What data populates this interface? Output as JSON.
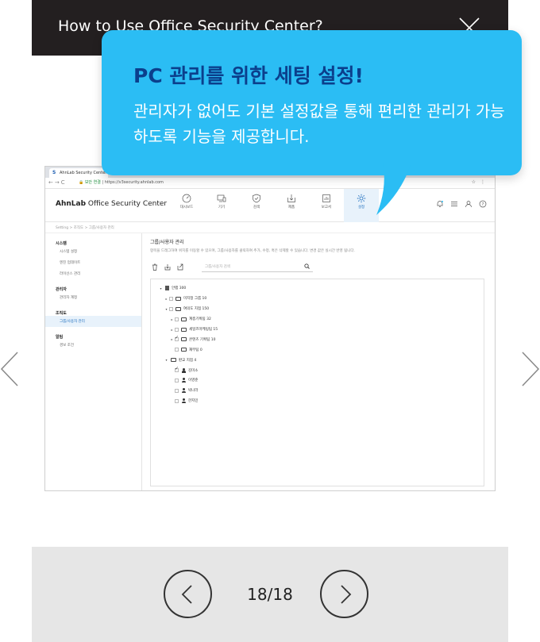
{
  "header": {
    "title": "How to Use Office Security Center?"
  },
  "callout": {
    "title": "PC 관리를 위한 세팅 설정!",
    "desc": "관리자가 없어도 기본 설정값을 통해 편리한 관리가 가능하도록 기능을 제공합니다."
  },
  "browser": {
    "tab_title": "AhnLab Security Center",
    "secure_label": "보안 연결",
    "url": "https://v3security.ahnlab.com"
  },
  "app": {
    "title_brand": "AhnLab",
    "title_rest": " Office Security Center",
    "menu": [
      {
        "label": "대시보드",
        "icon": "dashboard-icon"
      },
      {
        "label": "기기",
        "icon": "devices-icon"
      },
      {
        "label": "검색",
        "icon": "shield-check-icon"
      },
      {
        "label": "제품",
        "icon": "download-icon"
      },
      {
        "label": "보고서",
        "icon": "report-icon"
      },
      {
        "label": "설정",
        "icon": "gear-icon",
        "active": true
      }
    ],
    "breadcrumb": "Setting > 조직도 > 그룹/사용자 관리",
    "sidebar": [
      {
        "section": "시스템",
        "items": [
          "시스템 설정",
          "엔진 업데이트",
          "라이선스 관리"
        ]
      },
      {
        "section": "관리자",
        "items": [
          "관리자 계정"
        ]
      },
      {
        "section": "조직도",
        "items": [
          "그룹/사용자 관리"
        ]
      },
      {
        "section": "알림",
        "items": [
          "경보 조건"
        ]
      }
    ],
    "active_sidebar": "그룹/사용자 관리",
    "main_title": "그룹/사용자 관리",
    "main_desc": "항목을 드래그하여 위치를 이동할 수 있으며, 그룹/사용자를 클릭하여 추가, 수정, 혹은 삭제할 수 있습니다. 변경 값은 실시간 반영 됩니다.",
    "search_placeholder": "그룹/사용자 검색",
    "tree": [
      {
        "label": "안랩 300",
        "level": 0,
        "toggle": "▾",
        "kind": "org",
        "checkbox": false
      },
      {
        "label": "미지정 그룹 10",
        "level": 1,
        "toggle": "▸",
        "kind": "folder",
        "checkbox": true,
        "checked": false
      },
      {
        "label": "여의도 지점 150",
        "level": 1,
        "toggle": "▾",
        "kind": "folder",
        "checkbox": true,
        "checked": false
      },
      {
        "label": "계층기획팀 32",
        "level": 2,
        "toggle": "▸",
        "kind": "folder",
        "checkbox": true,
        "checked": false
      },
      {
        "label": "세일즈마케팅팀 15",
        "level": 2,
        "toggle": "▸",
        "kind": "folder",
        "checkbox": true,
        "checked": false
      },
      {
        "label": "콘텐츠 기획팀 10",
        "level": 2,
        "toggle": "▸",
        "kind": "folder",
        "checkbox": true,
        "checked": true
      },
      {
        "label": "재무팀 0",
        "level": 2,
        "toggle": "",
        "kind": "folder",
        "checkbox": true,
        "checked": false
      },
      {
        "label": "판교 지점 4",
        "level": 1,
        "toggle": "▾",
        "kind": "folder",
        "checkbox": false
      },
      {
        "label": "김미소",
        "level": 2,
        "toggle": "",
        "kind": "user",
        "checkbox": true,
        "checked": true
      },
      {
        "label": "이영준",
        "level": 2,
        "toggle": "",
        "kind": "user",
        "checkbox": true,
        "checked": false
      },
      {
        "label": "박나라",
        "level": 2,
        "toggle": "",
        "kind": "user",
        "checkbox": true,
        "checked": false
      },
      {
        "label": "한지민",
        "level": 2,
        "toggle": "",
        "kind": "user",
        "checkbox": true,
        "checked": false
      }
    ]
  },
  "pager": {
    "current": "18/18"
  },
  "colors": {
    "callout": "#2bbdf4",
    "callout_title": "#0b3f8c",
    "header": "#231f20",
    "pager_bg": "#e6e6e6"
  }
}
